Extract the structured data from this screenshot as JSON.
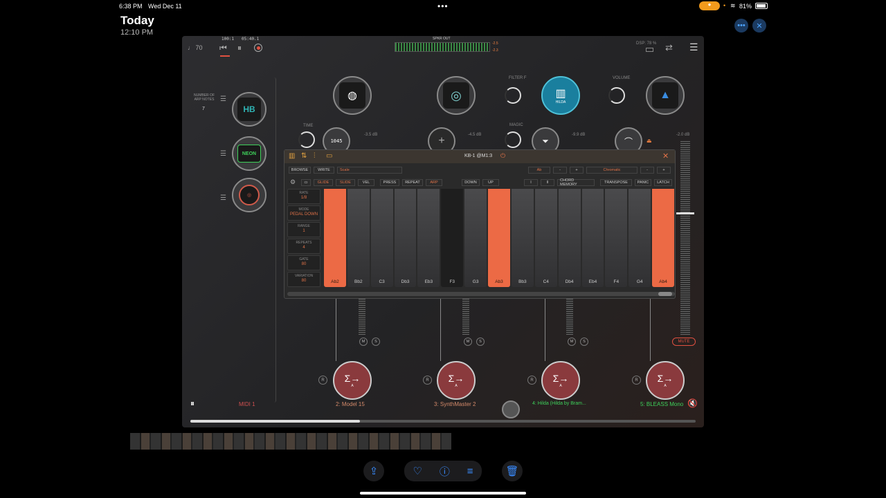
{
  "status": {
    "time": "6:38 PM",
    "date": "Wed Dec 11",
    "battery": "81%"
  },
  "header": {
    "title": "Today",
    "time": "12:10 PM"
  },
  "app": {
    "tempo": "♩ 70",
    "bars": "100:1",
    "clock": "05:40.1",
    "spkr_label": "SPKR OUT",
    "meter_vals": [
      "-2.5",
      "-2.3"
    ],
    "dsp": "DSP: 78 %",
    "arp_label": "NUMBER OF ARP NOTES",
    "arp_value": "7",
    "side_plugins": [
      {
        "name": "HB",
        "color": "#2fb4b4"
      },
      {
        "name": "NEON",
        "color": "#3ed15a"
      },
      {
        "name": "ring-icon",
        "color": "#d05a4a"
      }
    ],
    "knobs": [
      {
        "label": "TIME"
      },
      {
        "label": "FILTER F"
      },
      {
        "label": "MAGIC"
      },
      {
        "label": "VOLUME"
      }
    ],
    "db_values": [
      "-3.5 dB",
      "-4.5 dB",
      "-9.9 dB",
      "-2.0 dB"
    ],
    "hilda_label": "HILDA",
    "v1_text": "1045",
    "midi_label": "MIDI 1",
    "mute_label": "MUTE",
    "fx": [
      {
        "name": "2: Model 15",
        "color": "#d48a6a"
      },
      {
        "name": "3: SynthMaster 2",
        "color": "#d48a6a"
      },
      {
        "name": "4: Hilda (Hilda by Bram...",
        "color": "#3ed15a"
      },
      {
        "name": "5: BLEASS Mono",
        "color": "#3ed15a"
      }
    ]
  },
  "kb": {
    "title": "KB-1 @M1:3",
    "browse": "BROWSE",
    "write": "WRITE",
    "preset": "Scale",
    "key": "Ab",
    "scale": "Chromatic",
    "minus": "-",
    "plus": "+",
    "toggles": [
      "GLIDE",
      "SLIDE",
      "VEL",
      "PRESS",
      "REPEAT",
      "ARP"
    ],
    "down": "DOWN",
    "up": "UP",
    "roman": [
      "I",
      "II"
    ],
    "chord_memory": "CHORD MEMORY",
    "transpose": "TRANSPOSE",
    "panic": "PANIC",
    "latch": "LATCH",
    "left_params": [
      {
        "label": "RATE",
        "value": "1/8"
      },
      {
        "label": "MODE",
        "value": "PEDAL DOWN"
      },
      {
        "label": "RANGE",
        "value": "1"
      },
      {
        "label": "REPEATS",
        "value": "4"
      },
      {
        "label": "GATE",
        "value": "80"
      },
      {
        "label": "VARIATION",
        "value": "80"
      }
    ],
    "keys": [
      {
        "note": "Ab2",
        "on": true
      },
      {
        "note": "Bb2",
        "on": false
      },
      {
        "note": "C3",
        "on": false
      },
      {
        "note": "Db3",
        "on": false
      },
      {
        "note": "Eb3",
        "on": false
      },
      {
        "note": "F3",
        "on": false
      },
      {
        "note": "G3",
        "on": false
      },
      {
        "note": "Ab3",
        "on": true
      },
      {
        "note": "Bb3",
        "on": false
      },
      {
        "note": "C4",
        "on": false
      },
      {
        "note": "Db4",
        "on": false
      },
      {
        "note": "Eb4",
        "on": false
      },
      {
        "note": "F4",
        "on": false
      },
      {
        "note": "G4",
        "on": false
      },
      {
        "note": "Ab4",
        "on": true
      }
    ]
  }
}
